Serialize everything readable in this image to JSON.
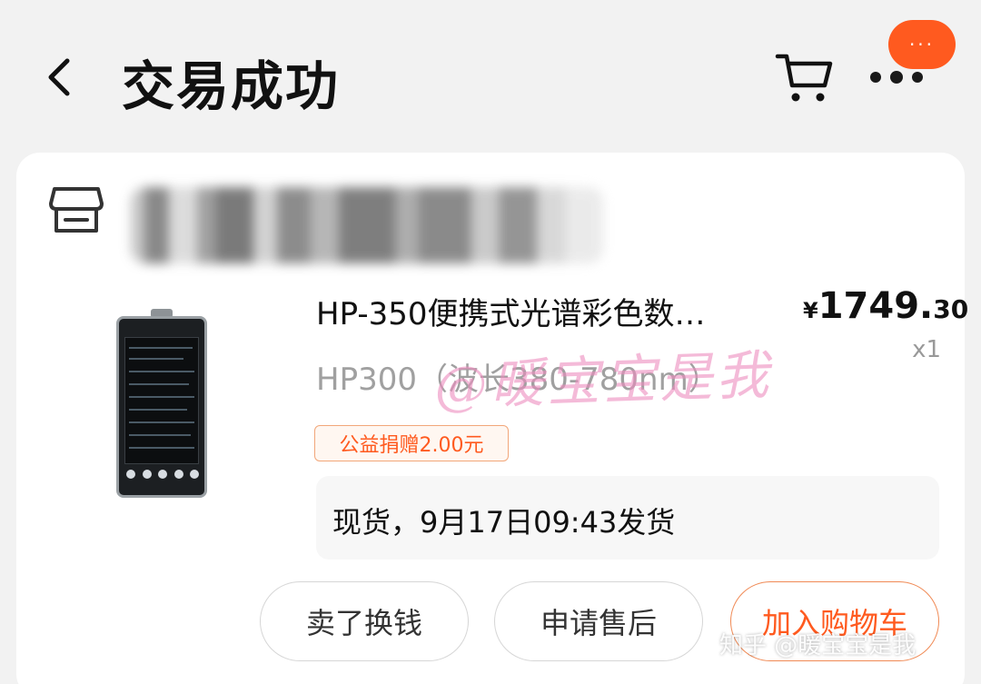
{
  "header": {
    "title": "交易成功",
    "back_icon": "chevron-left-icon",
    "cart_icon": "cart-icon",
    "more_icon": "more-dots-icon",
    "msg_bubble_text": "···"
  },
  "order": {
    "store_name": "",
    "store_icon": "store-icon",
    "product": {
      "title": "HP-350便携式光谱彩色数…",
      "price_symbol": "¥",
      "price_int": "1749.",
      "price_dec": "30",
      "quantity": "x1",
      "spec": "HP300（波长380-780nm）",
      "charity_tag": "公益捐赠2.00元"
    },
    "shipping_note": "现货，9月17日09:43发货",
    "actions": {
      "sell": "卖了换钱",
      "after_sale": "申请售后",
      "add_to_cart": "加入购物车"
    }
  },
  "watermarks": {
    "center": "@暖宝宝是我",
    "corner": "知乎 @暖宝宝是我"
  },
  "colors": {
    "accent": "#ff5a1f",
    "background": "#f2f2f2",
    "card": "#ffffff"
  }
}
